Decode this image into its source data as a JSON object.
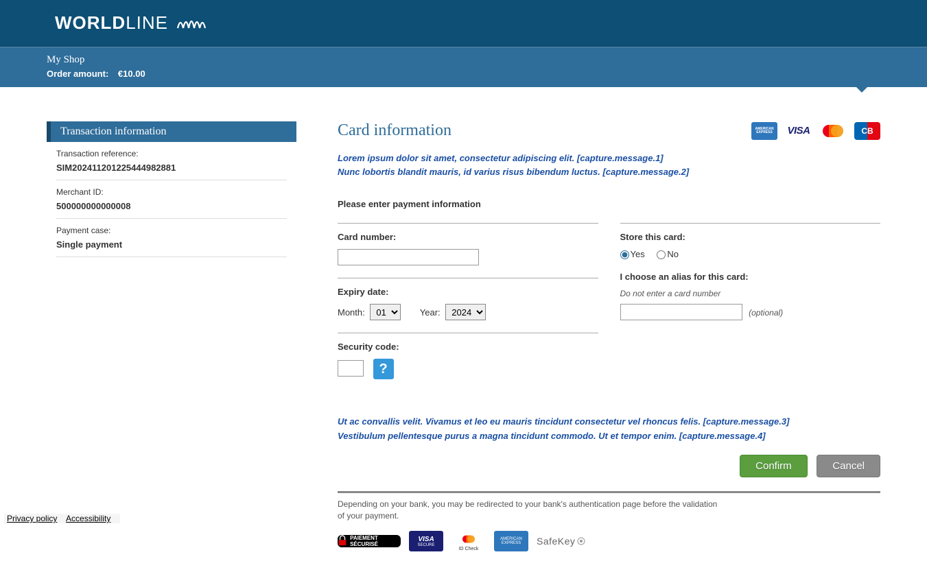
{
  "header": {
    "logo_world": "WORLD",
    "logo_line": "LINE"
  },
  "order_bar": {
    "shop_name": "My Shop",
    "amount_label": "Order amount:",
    "amount_value": "€10.00"
  },
  "sidebar": {
    "panel_title": "Transaction information",
    "items": [
      {
        "label": "Transaction reference:",
        "value": "SIM202411201225444982881"
      },
      {
        "label": "Merchant ID:",
        "value": "500000000000008"
      },
      {
        "label": "Payment case:",
        "value": "Single payment"
      }
    ]
  },
  "main": {
    "title": "Card information",
    "capture_msg_1": "Lorem ipsum dolor sit amet, consectetur adipiscing elit. [capture.message.1]",
    "capture_msg_2": "Nunc lobortis blandit mauris, id varius risus bibendum luctus. [capture.message.2]",
    "instruction": "Please enter payment information",
    "card_number_label": "Card number:",
    "expiry_label": "Expiry date:",
    "month_label": "Month:",
    "month_value": "01",
    "year_label": "Year:",
    "year_value": "2024",
    "security_label": "Security code:",
    "help_symbol": "?",
    "store_label": "Store this card:",
    "yes_label": "Yes",
    "no_label": "No",
    "alias_label": "I choose an alias for this card:",
    "alias_hint": "Do not enter a card number",
    "optional_hint": "(optional)",
    "capture_msg_3": "Ut ac convallis velit. Vivamus et leo eu mauris tincidunt consectetur vel rhoncus felis. [capture.message.3]",
    "capture_msg_4": "Vestibulum pellentesque purus a magna tincidunt commodo. Ut et tempor enim. [capture.message.4]",
    "confirm_btn": "Confirm",
    "cancel_btn": "Cancel",
    "footer_note": "Depending on your bank, you may be redirected to your bank's authentication page before the validation of your payment.",
    "secure_badges": {
      "paiement": "PAIEMENT SÉCURISÉ",
      "visa_top": "VISA",
      "visa_bot": "SECURE",
      "mc_bot": "ID Check",
      "amex_top": "AMERICAN",
      "amex_bot": "EXPRESS",
      "safekey": "SafeKey"
    },
    "card_logos": {
      "amex_top": "AMERICAN",
      "amex_bot": "EXPRESS",
      "visa": "VISA",
      "cb": "CB"
    }
  },
  "footer_links": {
    "privacy": "Privacy policy",
    "accessibility": "Accessibility"
  }
}
